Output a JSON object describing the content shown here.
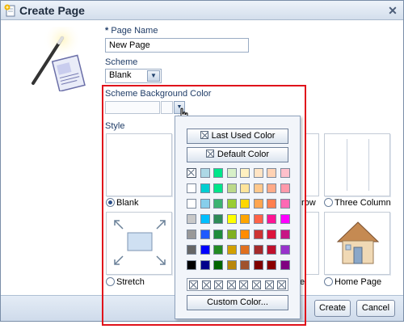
{
  "dialog": {
    "title": "Create Page",
    "close_label": "✕"
  },
  "form": {
    "page_name_label": "Page Name",
    "required_marker": "*",
    "page_name_value": "New Page",
    "scheme_label": "Scheme",
    "scheme_value": "Blank",
    "scheme_bg_label": "Scheme Background Color",
    "style_label": "Style"
  },
  "styles": [
    {
      "label": "Blank",
      "selected": true
    },
    {
      "label": "row",
      "selected": false
    },
    {
      "label": "Three Column",
      "selected": false
    },
    {
      "label": "Stretch",
      "selected": false
    },
    {
      "label": "e",
      "selected": false
    },
    {
      "label": "Home Page",
      "selected": false
    }
  ],
  "color_picker": {
    "last_used_label": "Last Used Color",
    "default_label": "Default Color",
    "custom_label": "Custom Color...",
    "swatches": [
      [
        "none",
        "#add8e6",
        "#00e68a",
        "#d7f0c8",
        "#fff0c0",
        "#ffe4c4",
        "#ffd2b4",
        "#ffc0cb"
      ],
      [
        "#ffffff",
        "#00ced1",
        "#00e68a",
        "#bcd98a",
        "#ffe49a",
        "#ffc88c",
        "#ffaa88",
        "#ff99aa"
      ],
      [
        "#ffffff",
        "#87ceeb",
        "#3cb371",
        "#9acd32",
        "#ffd700",
        "#ffa54f",
        "#ff7f50",
        "#ff69b4"
      ],
      [
        "#c8c8c8",
        "#00bfff",
        "#2e8b57",
        "#ffff00",
        "#ffa500",
        "#ff6347",
        "#ff1493",
        "#ff00ff"
      ],
      [
        "#999999",
        "#1e5aff",
        "#1e8c3c",
        "#80b020",
        "#ff8c00",
        "#cd3333",
        "#dc143c",
        "#c71585"
      ],
      [
        "#666666",
        "#0000ff",
        "#228b22",
        "#d2a000",
        "#e07020",
        "#a52a2a",
        "#c0102c",
        "#9932cc"
      ],
      [
        "#000000",
        "#00008b",
        "#006400",
        "#b8860b",
        "#a0522d",
        "#800000",
        "#8b0000",
        "#800080"
      ]
    ]
  },
  "footer": {
    "create_label": "Create",
    "cancel_label": "Cancel"
  },
  "colors": {
    "highlight": "#e0121b",
    "label_blue": "#1f3c67"
  }
}
